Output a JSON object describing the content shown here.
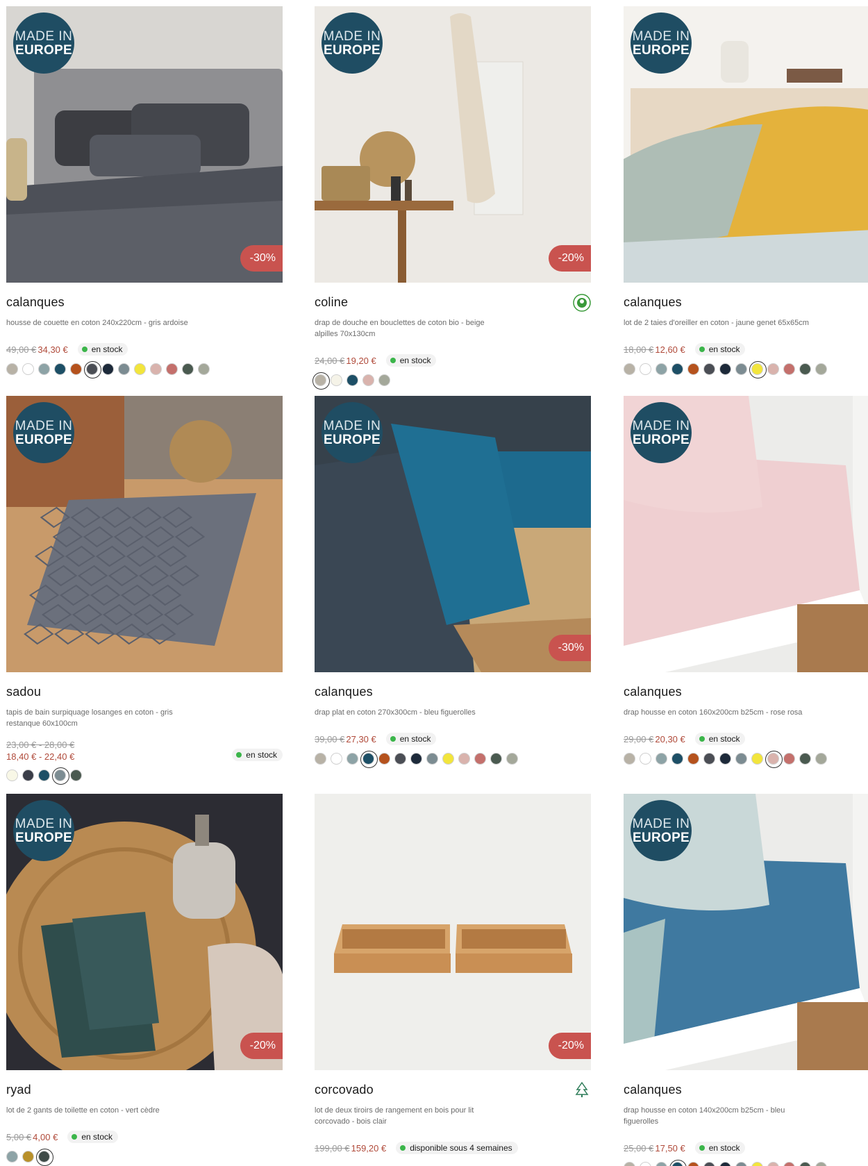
{
  "badges": {
    "made_in": "MADE IN",
    "europe": "EUROPE"
  },
  "products": [
    {
      "title": "calanques",
      "desc": "housse de couette en coton 240x220cm - gris ardoise",
      "old_price": "49,00 €",
      "new_price": "34,30 €",
      "stock": "en stock",
      "discount": "-30%",
      "made_in_europe": true,
      "swatches": [
        "#b8b2a6",
        "#ffffff",
        "#8da3a6",
        "#1d4f66",
        "#b5521d",
        "#4b4e55",
        "#1d2a3a",
        "#7c8c92",
        "#f2e53c",
        "#d9b3ad",
        "#c4706c",
        "#4a5a50",
        "#a4a89a"
      ],
      "selected_swatch": 5,
      "image": "bedroom-dark"
    },
    {
      "title": "coline",
      "desc": "drap de douche en bouclettes de coton bio - beige alpilles 70x130cm",
      "old_price": "24,00 €",
      "new_price": "19,20 €",
      "stock": "en stock",
      "discount": "-20%",
      "made_in_europe": true,
      "eco_icon": "organic-cotton-icon",
      "swatches": [
        "#b8b2a6",
        "#f5f3e8",
        "#1d4f66",
        "#d9b3ad",
        "#a4a89a"
      ],
      "selected_swatch": 0,
      "image": "towel"
    },
    {
      "title": "calanques",
      "desc": "lot de 2 taies d'oreiller en coton - jaune genet 65x65cm",
      "old_price": "18,00 €",
      "new_price": "12,60 €",
      "stock": "en stock",
      "discount": "",
      "made_in_europe": true,
      "swatches": [
        "#b8b2a6",
        "#ffffff",
        "#8da3a6",
        "#1d4f66",
        "#b5521d",
        "#4b4e55",
        "#1d2a3a",
        "#7c8c92",
        "#f2e53c",
        "#d9b3ad",
        "#c4706c",
        "#4a5a50",
        "#a4a89a"
      ],
      "selected_swatch": 8,
      "image": "pillows-yellow"
    },
    {
      "title": "sadou",
      "desc": "tapis de bain surpiquage losanges en coton - gris restanque 60x100cm",
      "old_price": "23,00 € - 28,00 €",
      "new_price": "18,40 € - 22,40 €",
      "stock": "en stock",
      "discount": "",
      "made_in_europe": true,
      "swatches": [
        "#f8f7e6",
        "#3a3d48",
        "#1d4f66",
        "#7c8c92",
        "#4a5a50"
      ],
      "selected_swatch": 3,
      "image": "bathmat"
    },
    {
      "title": "calanques",
      "desc": "drap plat en coton 270x300cm - bleu figuerolles",
      "old_price": "39,00 €",
      "new_price": "27,30 €",
      "stock": "en stock",
      "discount": "-30%",
      "made_in_europe": true,
      "swatches": [
        "#b8b2a6",
        "#ffffff",
        "#8da3a6",
        "#1d4f66",
        "#b5521d",
        "#4b4e55",
        "#1d2a3a",
        "#7c8c92",
        "#f2e53c",
        "#d9b3ad",
        "#c4706c",
        "#4a5a50",
        "#a4a89a"
      ],
      "selected_swatch": 3,
      "image": "sheet-blue"
    },
    {
      "title": "calanques",
      "desc": "drap housse en coton 160x200cm b25cm - rose rosa",
      "old_price": "29,00 €",
      "new_price": "20,30 €",
      "stock": "en stock",
      "discount": "",
      "made_in_europe": true,
      "swatches": [
        "#b8b2a6",
        "#ffffff",
        "#8da3a6",
        "#1d4f66",
        "#b5521d",
        "#4b4e55",
        "#1d2a3a",
        "#7c8c92",
        "#f2e53c",
        "#d9b3ad",
        "#c4706c",
        "#4a5a50",
        "#a4a89a"
      ],
      "selected_swatch": 9,
      "image": "fitted-pink"
    },
    {
      "title": "ryad",
      "desc": "lot de 2 gants de toilette en coton - vert cèdre",
      "old_price": "5,00 €",
      "new_price": "4,00 €",
      "stock": "en stock",
      "discount": "-20%",
      "made_in_europe": true,
      "swatches": [
        "#8da3a6",
        "#b8902a",
        "#3e4a47"
      ],
      "selected_swatch": 2,
      "image": "washcloths"
    },
    {
      "title": "corcovado",
      "desc": "lot de deux tiroirs de rangement en bois pour lit corcovado - bois clair",
      "old_price": "199,00 €",
      "new_price": "159,20 €",
      "stock": "disponible sous 4 semaines",
      "discount": "-20%",
      "made_in_europe": false,
      "eco_icon": "fsc-tree-icon",
      "swatches": [],
      "selected_swatch": -1,
      "image": "drawers"
    },
    {
      "title": "calanques",
      "desc": "drap housse en coton 140x200cm b25cm - bleu figuerolles",
      "old_price": "25,00 €",
      "new_price": "17,50 €",
      "stock": "en stock",
      "discount": "",
      "made_in_europe": true,
      "swatches": [
        "#b8b2a6",
        "#ffffff",
        "#8da3a6",
        "#1d4f66",
        "#b5521d",
        "#4b4e55",
        "#1d2a3a",
        "#7c8c92",
        "#f2e53c",
        "#d9b3ad",
        "#c4706c",
        "#4a5a50",
        "#a4a89a"
      ],
      "selected_swatch": 3,
      "image": "fitted-blue"
    }
  ]
}
